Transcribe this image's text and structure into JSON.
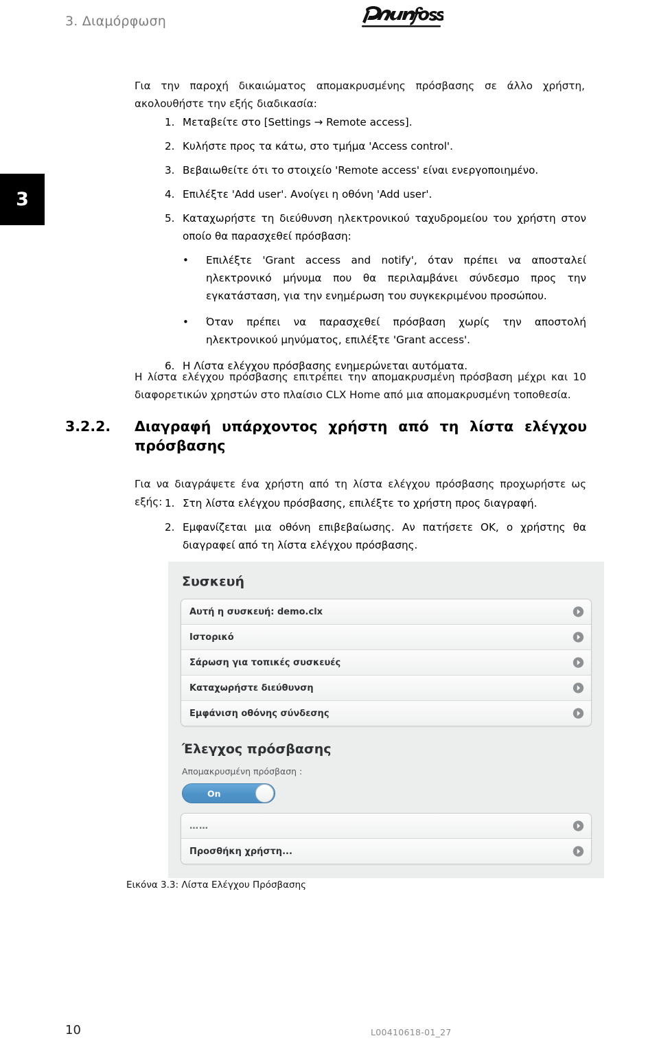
{
  "header": {
    "chapter_label": "3. Διαμόρφωση",
    "logo_text": "Danfoss",
    "chapter_tab_number": "3"
  },
  "body": {
    "intro_paragraph": "Για την παροχή δικαιώματος απομακρυσμένης πρόσβασης σε άλλο χρήστη, ακολουθήστε την εξής διαδικασία:",
    "steps": [
      {
        "num": "1.",
        "text": "Μεταβείτε στο [Settings → Remote access]."
      },
      {
        "num": "2.",
        "text": "Κυλήστε προς τα κάτω, στο τμήμα 'Access control'."
      },
      {
        "num": "3.",
        "text": "Βεβαιωθείτε ότι το στοιχείο 'Remote access' είναι ενεργοποιημένο."
      },
      {
        "num": "4.",
        "text": "Επιλέξτε 'Add user'. Ανοίγει η οθόνη 'Add user'."
      },
      {
        "num": "5.",
        "text": "Καταχωρήστε τη διεύθυνση ηλεκτρονικού ταχυδρομείου του χρήστη στον οποίο θα παρασχεθεί πρόσβαση:"
      }
    ],
    "bullets": [
      {
        "marker": "•",
        "text": "Επιλέξτε 'Grant access and notify', όταν πρέπει να αποσταλεί ηλεκτρονικό μήνυμα που θα περιλαμβάνει σύνδεσμο προς την εγκατάσταση, για την ενημέρωση του συγκεκριμένου προσώπου."
      },
      {
        "marker": "•",
        "text": "Όταν πρέπει να παρασχεθεί πρόσβαση χωρίς την αποστολή ηλεκτρονικού μηνύματος, επιλέξτε 'Grant access'."
      }
    ],
    "step_six": {
      "num": "6.",
      "text": "Η Λίστα ελέγχου πρόσβασης ενημερώνεται αυτόματα."
    },
    "note_paragraph": "Η λίστα ελέγχου πρόσβασης επιτρέπει την απομακρυσμένη πρόσβαση μέχρι και 10 διαφορετικών χρηστών στο πλαίσιο CLX Home από μια απομακρυσμένη τοποθεσία."
  },
  "section": {
    "number": "3.2.2.",
    "title": "Διαγραφή υπάρχοντος χρήστη από τη λίστα ελέγχου πρόσβασης",
    "intro": "Για να διαγράψετε ένα χρήστη από τη λίστα ελέγχου πρόσβασης προχωρήστε ως εξής:",
    "steps": [
      {
        "num": "1.",
        "text": "Στη λίστα ελέγχου πρόσβασης, επιλέξτε το χρήστη προς διαγραφή."
      },
      {
        "num": "2.",
        "text": "Εμφανίζεται μια οθόνη επιβεβαίωσης. Αν πατήσετε OK, ο χρήστης θα διαγραφεί από τη λίστα ελέγχου πρόσβασης."
      }
    ]
  },
  "figure": {
    "device_section_title": "Συσκευή",
    "device_rows": [
      {
        "label": "Αυτή η συσκευή: demo.clx"
      },
      {
        "label": "Ιστορικό"
      },
      {
        "label": "Σάρωση για τοπικές συσκευές"
      },
      {
        "label": "Καταχωρήστε διεύθυνση"
      },
      {
        "label": "Εμφάνιση οθόνης σύνδεσης"
      }
    ],
    "access_section_title": "Έλεγχος πρόσβασης",
    "remote_access_label": "Απομακρυσμένη πρόσβαση :",
    "toggle_state": "On",
    "toggle_color": "#4e93c8",
    "access_rows": [
      {
        "label": "……"
      },
      {
        "label": "Προσθήκη χρήστη..."
      }
    ],
    "caption": "Εικόνα 3.3: Λίστα Ελέγχου Πρόσβασης"
  },
  "footer": {
    "page_number": "10",
    "doc_code": "L00410618-01_27"
  }
}
